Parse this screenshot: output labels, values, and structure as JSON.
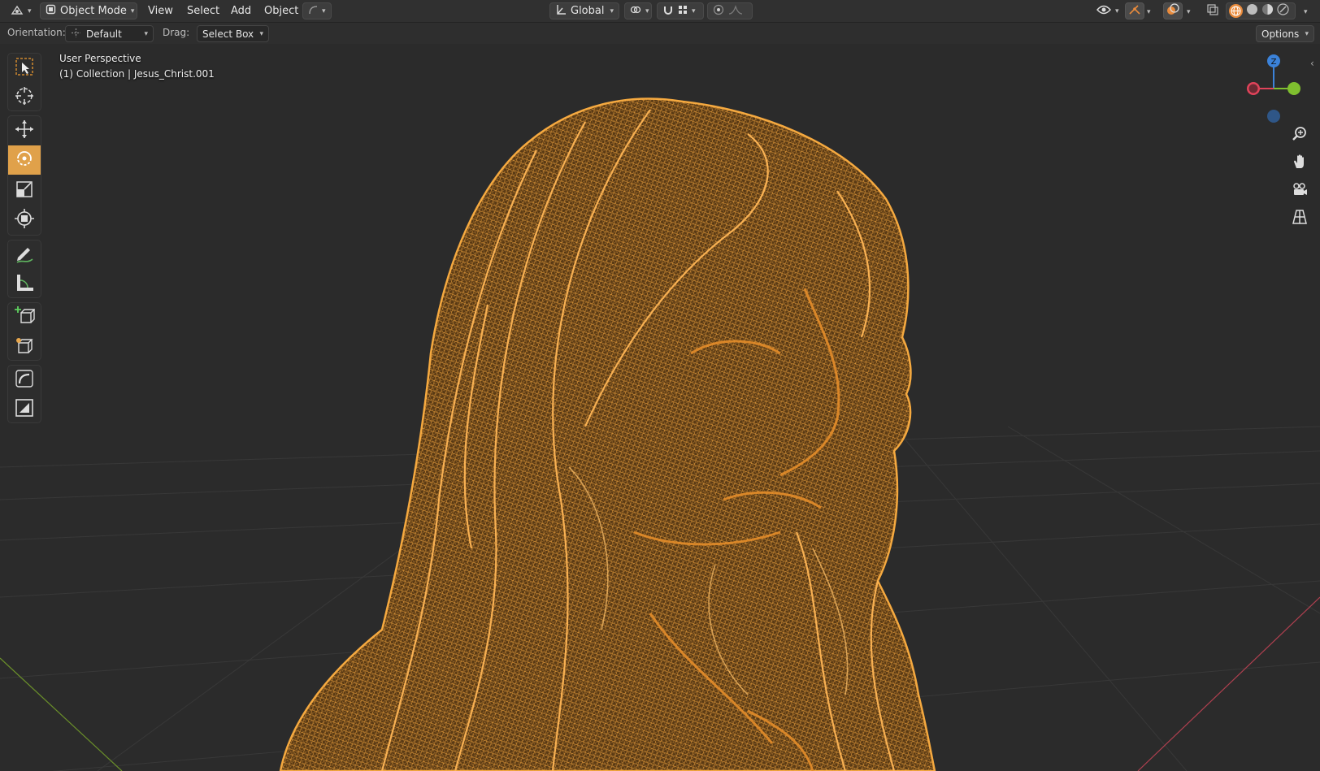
{
  "header": {
    "editor_type_icon": "viewport-3d-icon",
    "mode_label": "Object Mode",
    "menus": [
      "View",
      "Select",
      "Add",
      "Object"
    ],
    "transform_orientation": "Global",
    "right_icons": [
      "visibility-icon",
      "gizmo-icon",
      "overlay-icon",
      "xray-icon",
      "shading-wireframe-icon",
      "shading-solid-icon",
      "shading-material-icon",
      "shading-rendered-icon"
    ]
  },
  "tool_settings": {
    "orientation_label": "Orientation:",
    "orientation_value": "Default",
    "drag_label": "Drag:",
    "drag_value": "Select Box",
    "options_label": "Options"
  },
  "viewport": {
    "view_name": "User Perspective",
    "collection_info": "(1) Collection | Jesus_Christ.001",
    "shading": "wireframe",
    "wire_color": "#f0a23a",
    "background_color": "#2b2b2b",
    "active_tool": "rotate"
  },
  "gizmo": {
    "z_label": "Z",
    "x_color": "#e0435a",
    "y_color": "#7fbf2f",
    "z_color": "#3b82d9"
  },
  "toolbar": {
    "tools": [
      "select-box",
      "cursor",
      "move",
      "rotate",
      "scale",
      "transform",
      "annotate",
      "measure",
      "add-cube",
      "transform-cube",
      "curve",
      "image"
    ]
  },
  "colors": {
    "accent": "#e0a14a",
    "header_bg": "#303030",
    "toolbar_bg": "#2e2e2e"
  }
}
